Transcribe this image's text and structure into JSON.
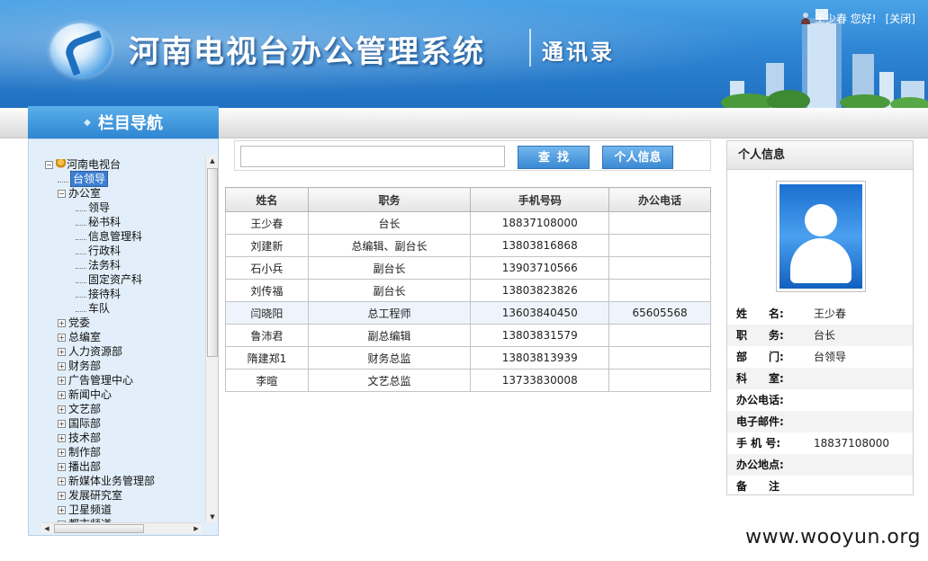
{
  "header": {
    "system_title": "河南电视台办公管理系统",
    "sub_title": "通讯录",
    "user_greeting": "王少春 您好!",
    "close_label": "[关闭]"
  },
  "nav": {
    "title": "栏目导航",
    "tree": {
      "root": "河南电视台",
      "selected": "台领导",
      "office": "办公室",
      "office_children": [
        "领导",
        "秘书科",
        "信息管理科",
        "行政科",
        "法务科",
        "固定资产科",
        "接待科",
        "车队"
      ],
      "departments": [
        "党委",
        "总编室",
        "人力资源部",
        "财务部",
        "广告管理中心",
        "新闻中心",
        "文艺部",
        "国际部",
        "技术部",
        "制作部",
        "播出部",
        "新媒体业务管理部",
        "发展研究室",
        "卫星频道",
        "都市频道"
      ]
    }
  },
  "search": {
    "placeholder": "",
    "find_label": "查找",
    "info_label": "个人信息"
  },
  "table": {
    "headers": [
      "姓名",
      "职务",
      "手机号码",
      "办公电话"
    ],
    "rows": [
      [
        "王少春",
        "台长",
        "18837108000",
        ""
      ],
      [
        "刘建新",
        "总编辑、副台长",
        "13803816868",
        ""
      ],
      [
        "石小兵",
        "副台长",
        "13903710566",
        ""
      ],
      [
        "刘传福",
        "副台长",
        "13803823826",
        ""
      ],
      [
        "闫晓阳",
        "总工程师",
        "13603840450",
        "65605568"
      ],
      [
        "鲁沛君",
        "副总编辑",
        "13803831579",
        ""
      ],
      [
        "隋建郑1",
        "财务总监",
        "13803813939",
        ""
      ],
      [
        "李暄",
        "文艺总监",
        "13733830008",
        ""
      ]
    ]
  },
  "profile": {
    "title": "个人信息",
    "fields": [
      {
        "label": "姓　　名:",
        "value": "王少春"
      },
      {
        "label": "职　　务:",
        "value": "台长"
      },
      {
        "label": "部　　门:",
        "value": "台领导"
      },
      {
        "label": "科　　室:",
        "value": ""
      },
      {
        "label": "办公电话:",
        "value": ""
      },
      {
        "label": "电子邮件:",
        "value": ""
      },
      {
        "label": "手 机 号:",
        "value": "18837108000"
      },
      {
        "label": "办公地点:",
        "value": ""
      },
      {
        "label": "备　　注",
        "value": ""
      }
    ]
  },
  "watermark": "www.wooyun.org",
  "colors": {
    "header_blue": "#2f86d4",
    "sidebar_bg": "#e2effa",
    "button_blue": "#3a89d3"
  }
}
